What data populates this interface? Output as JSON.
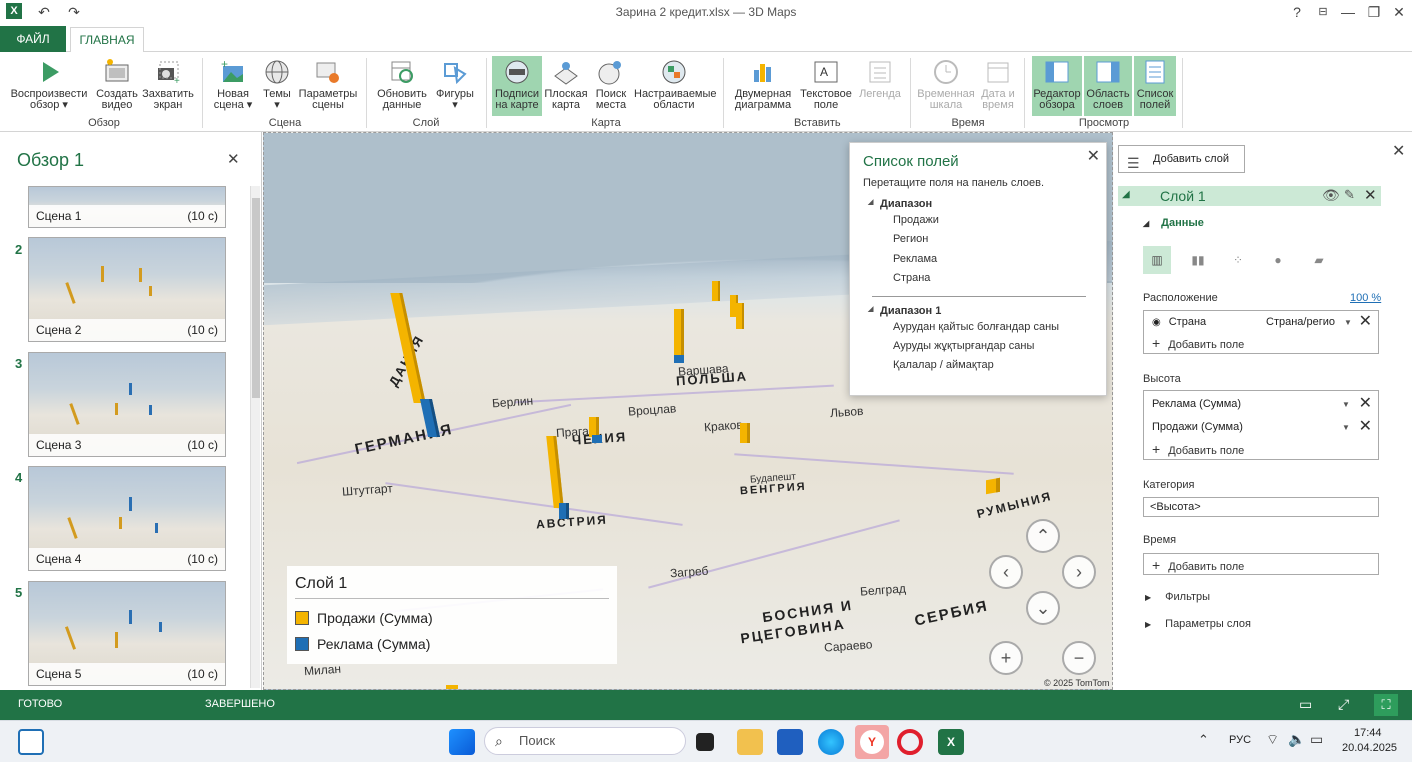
{
  "titlebar": {
    "title": "Зарина 2 кредит.xlsx — 3D Maps",
    "help": "?",
    "min": "—",
    "max": "❐",
    "close": "✕"
  },
  "tabs": {
    "file": "ФАЙЛ",
    "home": "ГЛАВНАЯ"
  },
  "ribbon": {
    "buttons": [
      {
        "label1": "Воспроизвести",
        "label2": "обзор ▾"
      },
      {
        "label1": "Создать",
        "label2": "видео"
      },
      {
        "label1": "Захватить",
        "label2": "экран"
      },
      {
        "label1": "Новая",
        "label2": "сцена ▾"
      },
      {
        "label1": "Темы",
        "label2": "▾"
      },
      {
        "label1": "Параметры",
        "label2": "сцены"
      },
      {
        "label1": "Обновить",
        "label2": "данные"
      },
      {
        "label1": "Фигуры",
        "label2": "▾"
      },
      {
        "label1": "Подписи",
        "label2": "на карте"
      },
      {
        "label1": "Плоская",
        "label2": "карта"
      },
      {
        "label1": "Поиск",
        "label2": "места"
      },
      {
        "label1": "Настраиваемые",
        "label2": "области"
      },
      {
        "label1": "Двумерная",
        "label2": "диаграмма"
      },
      {
        "label1": "Текстовое",
        "label2": "поле"
      },
      {
        "label1": "Легенда",
        "label2": ""
      },
      {
        "label1": "Временная",
        "label2": "шкала"
      },
      {
        "label1": "Дата и",
        "label2": "время"
      },
      {
        "label1": "Редактор",
        "label2": "обзора"
      },
      {
        "label1": "Область",
        "label2": "слоев"
      },
      {
        "label1": "Список",
        "label2": "полей"
      }
    ],
    "groups": [
      "Обзор",
      "Сцена",
      "Слой",
      "Карта",
      "Вставить",
      "Время",
      "Просмотр"
    ]
  },
  "tour": {
    "title": "Обзор 1",
    "close": "✕",
    "scenes": [
      {
        "num": "",
        "label": "Сцена 1",
        "duration": "(10 с)"
      },
      {
        "num": "2",
        "label": "Сцена 2",
        "duration": "(10 с)"
      },
      {
        "num": "3",
        "label": "Сцена 3",
        "duration": "(10 с)"
      },
      {
        "num": "4",
        "label": "Сцена 4",
        "duration": "(10 с)"
      },
      {
        "num": "5",
        "label": "Сцена 5",
        "duration": "(10 с)"
      }
    ]
  },
  "map": {
    "labels": {
      "germany": "ГЕРМАНИЯ",
      "austria": "АВСТРИЯ",
      "czech": "ЧЕХИЯ",
      "poland": "ПОЛЬША",
      "hungary": "ВЕНГРИЯ",
      "romania": "РУМЫНИЯ",
      "bosnia1": "БОСНИЯ И",
      "bosnia2": "РЦЕГОВИНА",
      "serbia": "СЕРБИЯ",
      "dania": "ДАНИЯ",
      "prague": "Прага",
      "berlin": "Берлин",
      "wroclaw": "Вроцлав",
      "krakow": "Краков",
      "budapest": "Будапешт",
      "zagreb": "Загреб",
      "belgrade": "Белград",
      "sarajevo": "Сараево",
      "milan": "Милан",
      "lviv": "Львов",
      "stuttgart": "Штутгарт",
      "warsaw": "Варшава"
    },
    "copyright": "© 2025 TomTom",
    "nav": {
      "up": "⌃",
      "left": "‹",
      "right": "›",
      "down": "⌄",
      "zoom_in": "+",
      "zoom_out": "−"
    }
  },
  "legend": {
    "title": "Слой 1",
    "items": [
      {
        "label": "Продажи (Сумма)",
        "color": "#f4b400"
      },
      {
        "label": "Реклама (Сумма)",
        "color": "#1f6fb5"
      }
    ]
  },
  "fieldlist": {
    "title": "Список полей",
    "hint": "Перетащите поля на панель слоев.",
    "close": "✕",
    "groups": [
      {
        "name": "Диапазон",
        "items": [
          "Продажи",
          "Регион",
          "Реклама",
          "Страна"
        ]
      },
      {
        "name": "Диапазон 1",
        "items": [
          "Аурудан қайтыс болғандар саны",
          "Ауруды жұқтырғандар саны",
          "Қалалар / аймақтар"
        ]
      }
    ]
  },
  "layerpane": {
    "add_layer": "Добавить слой",
    "layer_name": "Слой 1",
    "data_section": "Данные",
    "location_label": "Расположение",
    "location_pct": "100 %",
    "location_field": "Страна",
    "location_type": "Страна/регио",
    "add_field": "Добавить поле",
    "height_label": "Высота",
    "height_fields": [
      "Реклама (Сумма)",
      "Продажи (Сумма)"
    ],
    "category_label": "Категория",
    "category_value": "<Высота>",
    "time_label": "Время",
    "filters": "Фильтры",
    "layer_options": "Параметры слоя"
  },
  "status": {
    "left": "ГОТОВО",
    "mid": "ЗАВЕРШЕНО"
  },
  "taskbar": {
    "search": "Поиск",
    "lang": "РУС",
    "time": "17:44",
    "date": "20.04.2025"
  },
  "colors": {
    "accent": "#217346",
    "sales": "#f4b400",
    "ads": "#1f6fb5",
    "selected_ribbon": "#9fd5b0"
  }
}
